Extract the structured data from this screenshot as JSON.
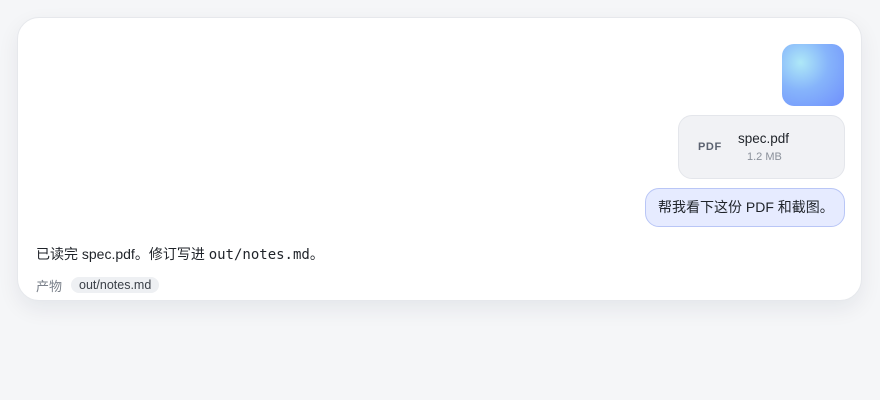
{
  "attachments": {
    "image_thumbnail": {
      "colors": [
        "#aee8f7",
        "#86b4fb",
        "#6f8ffc"
      ]
    },
    "file": {
      "type_label": "PDF",
      "name": "spec.pdf",
      "size": "1.2 MB"
    }
  },
  "user_message": "帮我看下这份 PDF 和截图。",
  "assistant_message": {
    "prefix": "已读完 spec.pdf。修订写进 ",
    "code": "out/notes.md",
    "suffix": "。"
  },
  "artifacts": {
    "label": "产物",
    "items": [
      "out/notes.md"
    ]
  }
}
